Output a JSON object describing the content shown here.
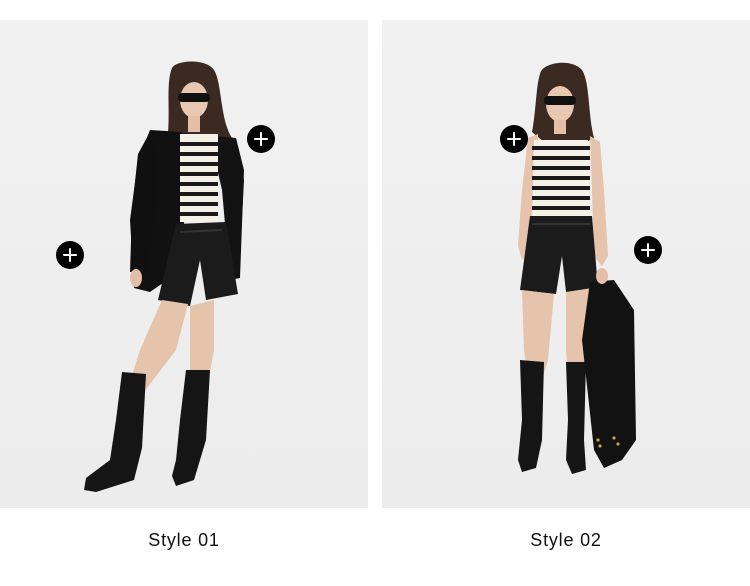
{
  "looks": [
    {
      "caption": "Style 01",
      "hotspots": [
        "hotspot-blazer",
        "hotspot-top-shorts"
      ]
    },
    {
      "caption": "Style 02",
      "hotspots": [
        "hotspot-tank-top",
        "hotspot-shorts"
      ]
    }
  ],
  "hotspot_icon": "plus-icon",
  "colors": {
    "hotspot_bg": "#000000",
    "hotspot_fg": "#ffffff",
    "background": "#ececec",
    "caption": "#111111"
  }
}
